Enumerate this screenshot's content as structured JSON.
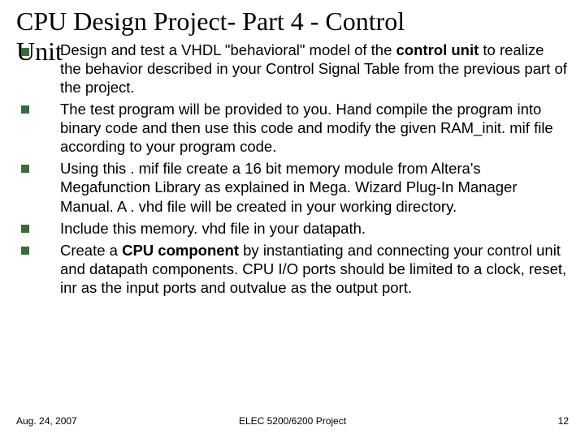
{
  "title_line1": "CPU Design Project- Part 4 - Control",
  "title_line2": "Unit",
  "bullets": [
    {
      "pre": "Design and test a VHDL \"behavioral\" model of the ",
      "bold1": "control unit",
      "post": " to realize the behavior described in your Control Signal Table from the previous part of the project."
    },
    {
      "pre": "The test program will be provided to you. Hand compile the program into binary code and then use this code and modify the given RAM_init. mif file according to your program code.",
      "bold1": "",
      "post": ""
    },
    {
      "pre": "Using this . mif file create a 16 bit memory module from Altera's Megafunction Library as explained in Mega. Wizard Plug-In Manager Manual. A . vhd file will be created in your working directory.",
      "bold1": "",
      "post": ""
    },
    {
      "pre": "Include this memory. vhd file in your datapath.",
      "bold1": "",
      "post": ""
    },
    {
      "pre": "Create a ",
      "bold1": "CPU component",
      "post": " by instantiating and connecting your control unit and datapath components. CPU I/O ports should be limited to a clock, reset, inr as the input ports and outvalue as the output port."
    }
  ],
  "footer": {
    "date": "Aug. 24, 2007",
    "center": "ELEC 5200/6200 Project",
    "page": "12"
  }
}
